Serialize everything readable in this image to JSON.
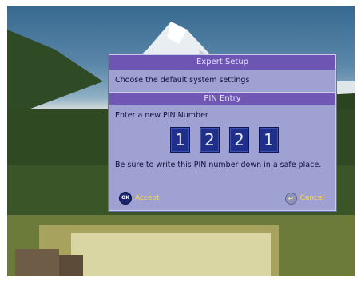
{
  "dialog": {
    "title": "Expert Setup",
    "subtitle": "Choose the default system settings",
    "section_title": "PIN Entry",
    "prompt": "Enter a new PIN Number",
    "pin_digits": [
      "1",
      "2",
      "2",
      "1"
    ],
    "note": "Be sure to write this PIN number down in a safe place.",
    "accept": {
      "icon_text": "OK",
      "label": "Accept",
      "icon": "ok-button-icon"
    },
    "cancel": {
      "label": "Cancel",
      "icon": "back-arrow-icon"
    }
  },
  "colors": {
    "dialog_bg": "#9ea1d2",
    "title_bar": "#6c55b3",
    "digit_box": "#1f2f8a",
    "action_label": "#ffd54a"
  }
}
